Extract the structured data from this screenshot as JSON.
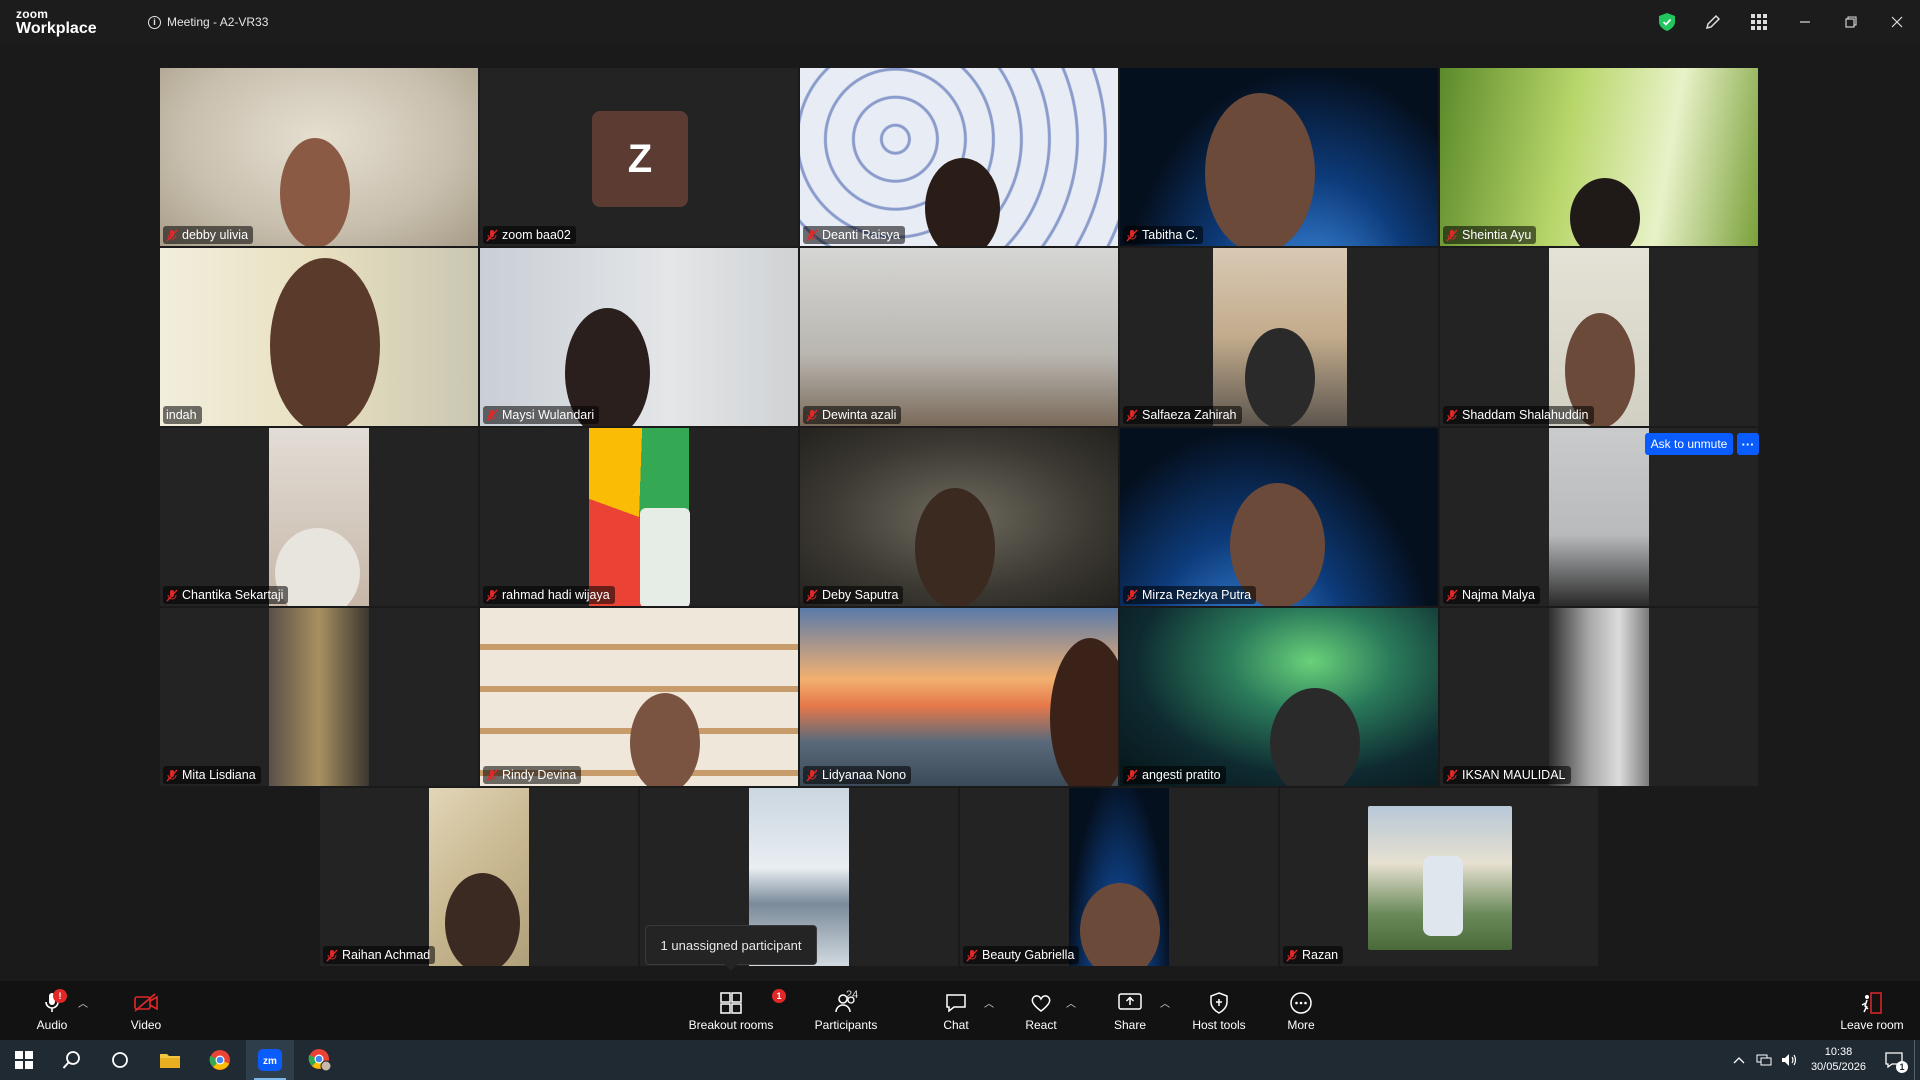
{
  "app": {
    "logo_top": "zoom",
    "logo_bottom": "Workplace",
    "meeting_title": "Meeting - A2-VR33"
  },
  "participants": [
    {
      "name": "debby ulivia"
    },
    {
      "name": "zoom baa02",
      "initial": "Z"
    },
    {
      "name": "Deanti Raisya"
    },
    {
      "name": "Tabitha C."
    },
    {
      "name": "Sheintia Ayu"
    },
    {
      "name": "indah",
      "active_speaker": true
    },
    {
      "name": "Maysi Wulandari"
    },
    {
      "name": "Dewinta azali"
    },
    {
      "name": "Salfaeza Zahirah"
    },
    {
      "name": "Shaddam Shalahuddin"
    },
    {
      "name": "Chantika Sekartaji"
    },
    {
      "name": "rahmad hadi wijaya"
    },
    {
      "name": "Deby Saputra"
    },
    {
      "name": "Mirza Rezkya Putra"
    },
    {
      "name": "Najma Malya"
    },
    {
      "name": "Mita Lisdiana"
    },
    {
      "name": "Rindy Devina"
    },
    {
      "name": "Lidyanaa Nono"
    },
    {
      "name": "angesti pratito"
    },
    {
      "name": "IKSAN MAULIDAL"
    },
    {
      "name": "Raihan Achmad"
    },
    {
      "name": "Beauty Gabriella"
    },
    {
      "name": "Razan"
    }
  ],
  "overlay": {
    "ask_to_unmute": "Ask to unmute",
    "more": "···",
    "tooltip": "1 unassigned participant"
  },
  "toolbar": {
    "audio": "Audio",
    "video": "Video",
    "breakout": "Breakout rooms",
    "breakout_badge": "1",
    "participants": "Participants",
    "participant_count": "24",
    "chat": "Chat",
    "react": "React",
    "share": "Share",
    "host_tools": "Host tools",
    "more": "More",
    "leave": "Leave room",
    "audio_badge": "!"
  },
  "taskbar": {
    "time": "10:38",
    "date": "30/05/2026",
    "notif_count": "1"
  },
  "colors": {
    "active_border": "#2dd17a",
    "accent_blue": "#0b5cff",
    "mute_red": "#e02828"
  }
}
